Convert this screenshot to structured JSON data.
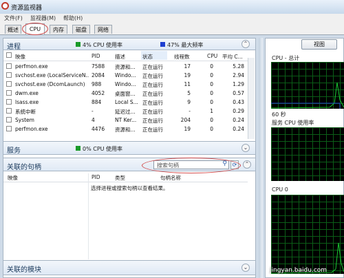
{
  "window": {
    "title": "资源监视器"
  },
  "menu": [
    "文件(F)",
    "监视器(M)",
    "帮助(H)"
  ],
  "tabs": [
    "概述",
    "CPU",
    "内存",
    "磁盘",
    "网络"
  ],
  "processes": {
    "title": "进程",
    "cpu_usage_label": "4% CPU 使用率",
    "max_freq_label": "47% 最大频率",
    "columns": [
      "映像",
      "PID",
      "描述",
      "状态",
      "线程数",
      "CPU",
      "平均 C..."
    ],
    "rows": [
      [
        "perfmon.exe",
        "7588",
        "资源和...",
        "正在运行",
        "17",
        "0",
        "5.28"
      ],
      [
        "svchost.exe (LocalServiceN...",
        "2084",
        "Windo...",
        "正在运行",
        "19",
        "0",
        "2.94"
      ],
      [
        "svchost.exe (DcomLaunch)",
        "988",
        "Windo...",
        "正在运行",
        "11",
        "0",
        "1.29"
      ],
      [
        "dwm.exe",
        "4052",
        "桌面窗...",
        "正在运行",
        "5",
        "0",
        "0.57"
      ],
      [
        "lsass.exe",
        "884",
        "Local S...",
        "正在运行",
        "9",
        "0",
        "0.43"
      ],
      [
        "系统中断",
        "-",
        "延迟过...",
        "正在运行",
        "-",
        "1",
        "0.29"
      ],
      [
        "System",
        "4",
        "NT Ker...",
        "正在运行",
        "204",
        "0",
        "0.24"
      ],
      [
        "perfmon.exe",
        "4476",
        "资源和...",
        "正在运行",
        "19",
        "0",
        "0.24"
      ]
    ]
  },
  "services": {
    "title": "服务",
    "cpu_usage_label": "0% CPU 使用率"
  },
  "handles": {
    "title": "关联的句柄",
    "search_placeholder": "搜索句柄",
    "columns": [
      "映像",
      "PID",
      "类型",
      "句柄名称"
    ],
    "empty_message": "选择进程或搜索句柄以查看结果。"
  },
  "modules": {
    "title": "关联的模块"
  },
  "right": {
    "view_label": "视图",
    "graph1_label": "CPU - 总计",
    "graph1_time": "60 秒",
    "graph2_label": "服务 CPU 使用率",
    "graph3_label": "CPU 0",
    "watermark": "jingyan.baidu.com"
  },
  "colors": {
    "cpu_legend": "#1a9a2a",
    "freq_legend": "#1f3fd0",
    "graph_line": "#19c832",
    "annotation": "#d24a4a"
  }
}
